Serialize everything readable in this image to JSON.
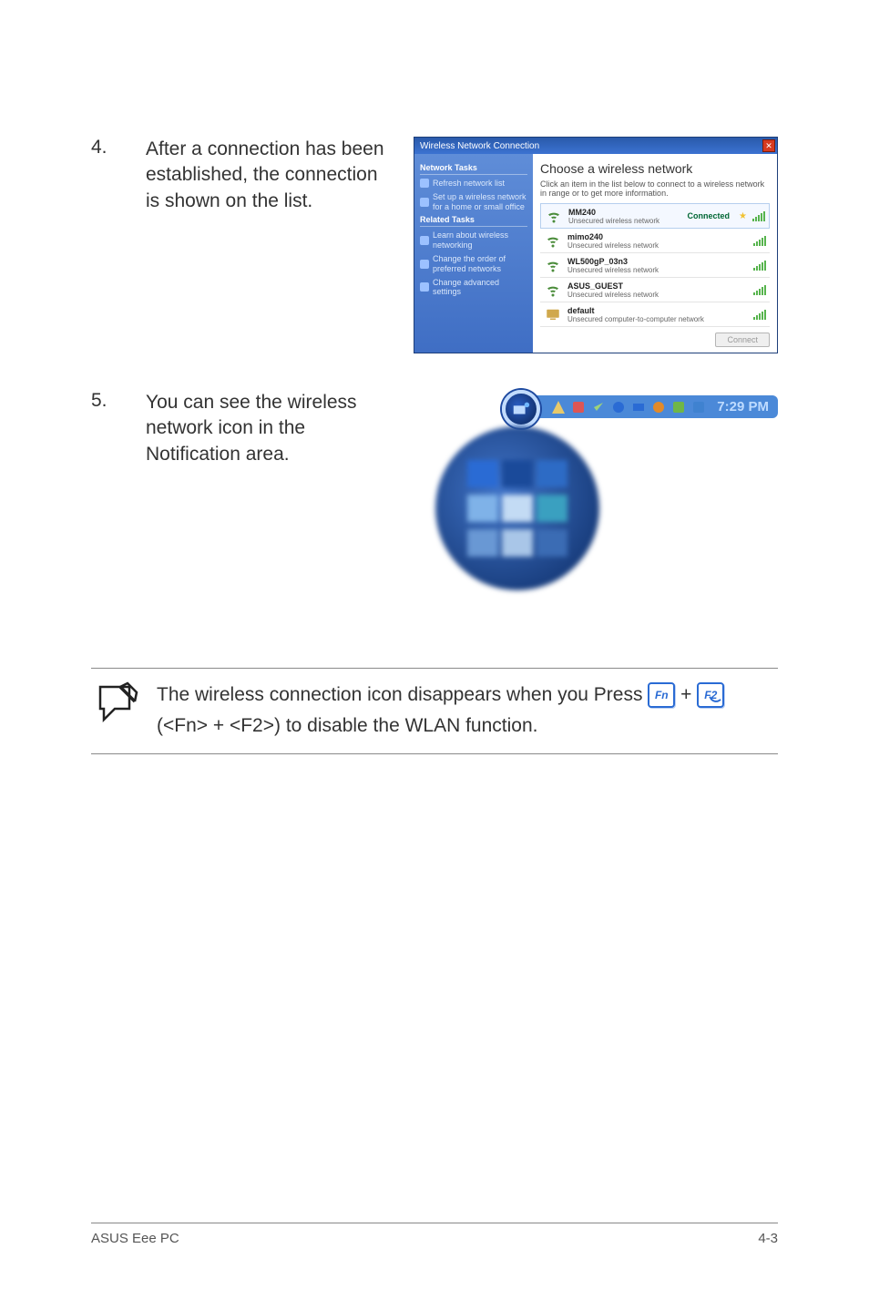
{
  "step4": {
    "number": "4.",
    "text": "After a connection has been established, the connection is shown on the list."
  },
  "step5": {
    "number": "5.",
    "text": "You can see the wireless network icon in the Notification area."
  },
  "dialog": {
    "title": "Wireless Network Connection",
    "side_head1": "Network Tasks",
    "side_refresh": "Refresh network list",
    "side_setup": "Set up a wireless network for a home or small office",
    "side_head2": "Related Tasks",
    "side_learn": "Learn about wireless networking",
    "side_order": "Change the order of preferred networks",
    "side_adv": "Change advanced settings",
    "main_head": "Choose a wireless network",
    "main_sub": "Click an item in the list below to connect to a wireless network in range or to get more information.",
    "net1_name": "MM240",
    "net1_sub": "Unsecured wireless network",
    "net1_conn": "Connected",
    "net2_name": "mimo240",
    "net2_sub": "Unsecured wireless network",
    "net3_name": "WL500gP_03n3",
    "net3_sub": "Unsecured wireless network",
    "net4_name": "ASUS_GUEST",
    "net4_sub": "Unsecured wireless network",
    "net5_name": "default",
    "net5_sub": "Unsecured computer-to-computer network",
    "connect_btn": "Connect"
  },
  "tray": {
    "time": "7:29 PM"
  },
  "note": {
    "prefix": "The wireless connection icon disappears when you Press ",
    "key1": "Fn",
    "plus": " + ",
    "key2": "F2",
    "suffix": " (<Fn> + <F2>) to disable the WLAN function."
  },
  "footer": {
    "left": "ASUS Eee PC",
    "right": "4-3"
  }
}
